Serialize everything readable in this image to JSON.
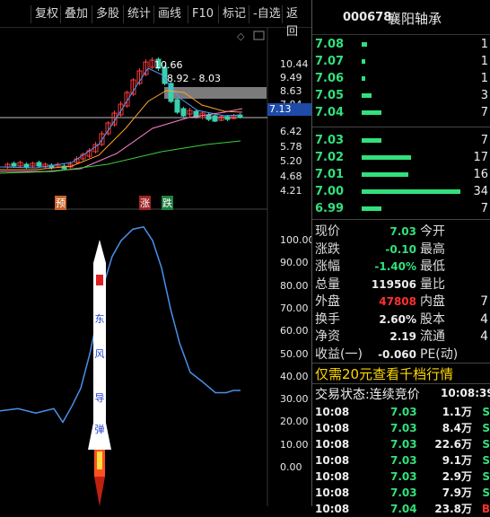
{
  "toolbar": {
    "buttons": [
      "复权",
      "叠加",
      "多股",
      "统计",
      "画线",
      "F10",
      "标记",
      "-自选",
      "返回"
    ]
  },
  "kline": {
    "price_axis": [
      "10.44",
      "9.49",
      "8.63",
      "7.84",
      "7.13",
      "6.42",
      "5.78",
      "5.20",
      "4.68",
      "4.21"
    ],
    "current_price_tag": "7.13",
    "high_label": "10.66",
    "range_label": "8.92 - 8.03",
    "markers": [
      "预",
      "涨",
      "跌"
    ],
    "colors": {
      "up": "#ff3b3b",
      "down": "#3ccfae",
      "ma5": "#4a9cff",
      "ma10": "#ffa030",
      "ma20": "#ff7fd0",
      "ma60": "#3ad03a"
    }
  },
  "indicator": {
    "axis": [
      "100.00",
      "90.00",
      "80.00",
      "70.00",
      "60.00",
      "50.00",
      "40.00",
      "30.00",
      "20.00",
      "10.00",
      "0.00"
    ],
    "rocket_text": [
      "东",
      "风",
      "导",
      "弹"
    ],
    "line_color": "#4a90e8"
  },
  "stock": {
    "code": "000678",
    "name": "襄阳轴承"
  },
  "orderbook": {
    "asks": [
      {
        "price": "7.08",
        "vol": "1"
      },
      {
        "price": "7.07",
        "vol": "1"
      },
      {
        "price": "7.06",
        "vol": "1"
      },
      {
        "price": "7.05",
        "vol": "3"
      },
      {
        "price": "7.04",
        "vol": "7"
      }
    ],
    "bids": [
      {
        "price": "7.03",
        "vol": "7"
      },
      {
        "price": "7.02",
        "vol": "17"
      },
      {
        "price": "7.01",
        "vol": "16"
      },
      {
        "price": "7.00",
        "vol": "34"
      },
      {
        "price": "6.99",
        "vol": "7"
      }
    ],
    "ask_bar_fractions": [
      0.05,
      0.04,
      0.04,
      0.1,
      0.2
    ],
    "bid_bar_fractions": [
      0.2,
      0.5,
      0.47,
      1.0,
      0.2
    ]
  },
  "quote": {
    "rows": [
      {
        "l1": "现价",
        "v1": "7.03",
        "c1": "green",
        "l2": "今开",
        "v2": ""
      },
      {
        "l1": "涨跌",
        "v1": "-0.10",
        "c1": "green",
        "l2": "最高",
        "v2": ""
      },
      {
        "l1": "涨幅",
        "v1": "-1.40%",
        "c1": "green",
        "l2": "最低",
        "v2": ""
      },
      {
        "l1": "总量",
        "v1": "119506",
        "c1": "white",
        "l2": "量比",
        "v2": ""
      },
      {
        "l1": "外盘",
        "v1": "47808",
        "c1": "red",
        "l2": "内盘",
        "v2": "7"
      },
      {
        "l1": "换手",
        "v1": "2.60%",
        "c1": "white",
        "l2": "股本",
        "v2": "4"
      },
      {
        "l1": "净资",
        "v1": "2.19",
        "c1": "white",
        "l2": "流通",
        "v2": "4"
      },
      {
        "l1": "收益(一)",
        "v1": "-0.060",
        "c1": "white",
        "l2": "PE(动)",
        "v2": ""
      }
    ]
  },
  "promo": "仅需20元查看千档行情",
  "trade_status": {
    "label": "交易状态:",
    "value": "连续竞价",
    "time": "10:08:39"
  },
  "trades": [
    {
      "time": "10:08",
      "price": "7.03",
      "vol": "1.1万",
      "flag": "S"
    },
    {
      "time": "10:08",
      "price": "7.03",
      "vol": "8.4万",
      "flag": "S"
    },
    {
      "time": "10:08",
      "price": "7.03",
      "vol": "22.6万",
      "flag": "S"
    },
    {
      "time": "10:08",
      "price": "7.03",
      "vol": "9.1万",
      "flag": "S"
    },
    {
      "time": "10:08",
      "price": "7.03",
      "vol": "2.9万",
      "flag": "S"
    },
    {
      "time": "10:08",
      "price": "7.03",
      "vol": "7.9万",
      "flag": "S"
    },
    {
      "time": "10:08",
      "price": "7.04",
      "vol": "23.8万",
      "flag": "B"
    }
  ]
}
